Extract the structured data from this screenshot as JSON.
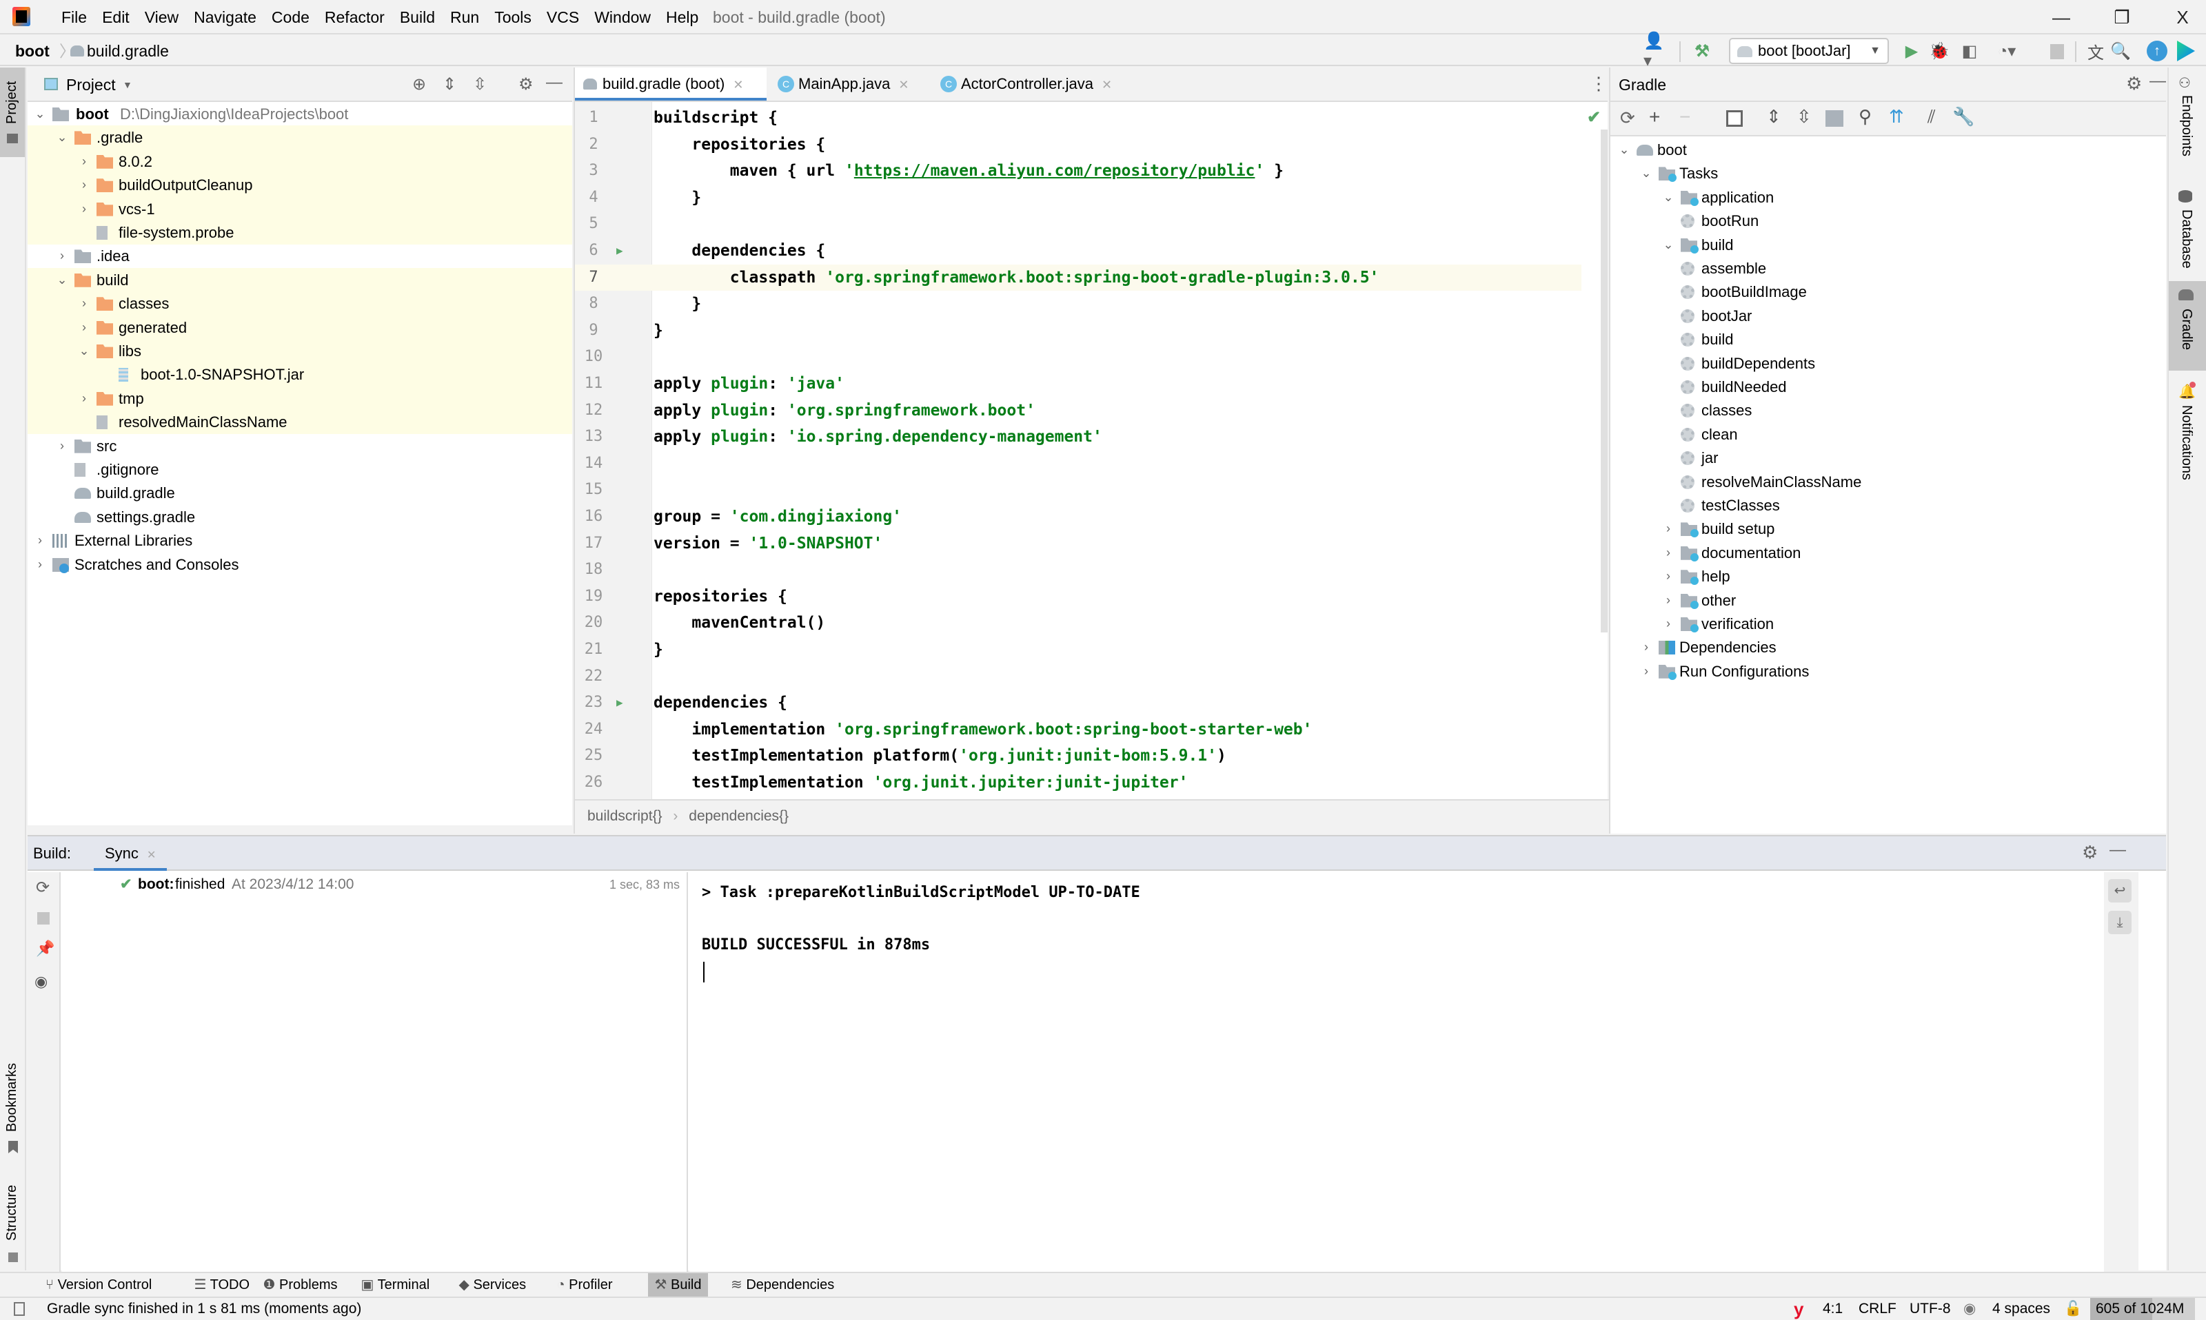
{
  "window": {
    "title": "boot - build.gradle (boot)",
    "menu": [
      "File",
      "Edit",
      "View",
      "Navigate",
      "Code",
      "Refactor",
      "Build",
      "Run",
      "Tools",
      "VCS",
      "Window",
      "Help"
    ],
    "controls": {
      "minimize": "—",
      "restore": "❐",
      "close": "X"
    }
  },
  "navbar": {
    "project": "boot",
    "file": "build.gradle",
    "run_config": "boot [bootJar]"
  },
  "left_stripe": {
    "top_tab": "Project",
    "bottom_tabs": [
      "Bookmarks",
      "Structure"
    ]
  },
  "project_panel": {
    "title": "Project",
    "root": {
      "name": "boot",
      "path": "D:\\DingJiaxiong\\IdeaProjects\\boot"
    },
    "items": [
      {
        "label": ".gradle",
        "depth": 1,
        "type": "folder-orange",
        "state": "expanded",
        "hl": true
      },
      {
        "label": "8.0.2",
        "depth": 2,
        "type": "folder-orange",
        "state": "collapsed",
        "hl": true
      },
      {
        "label": "buildOutputCleanup",
        "depth": 2,
        "type": "folder-orange",
        "state": "collapsed",
        "hl": true
      },
      {
        "label": "vcs-1",
        "depth": 2,
        "type": "folder-orange",
        "state": "collapsed",
        "hl": true
      },
      {
        "label": "file-system.probe",
        "depth": 2,
        "type": "file",
        "state": "none",
        "hl": true
      },
      {
        "label": ".idea",
        "depth": 1,
        "type": "folder-gray",
        "state": "collapsed",
        "hl": false
      },
      {
        "label": "build",
        "depth": 1,
        "type": "folder-orange",
        "state": "expanded",
        "hl": true
      },
      {
        "label": "classes",
        "depth": 2,
        "type": "folder-orange",
        "state": "collapsed",
        "hl": true
      },
      {
        "label": "generated",
        "depth": 2,
        "type": "folder-orange",
        "state": "collapsed",
        "hl": true
      },
      {
        "label": "libs",
        "depth": 2,
        "type": "folder-orange",
        "state": "expanded",
        "hl": true
      },
      {
        "label": "boot-1.0-SNAPSHOT.jar",
        "depth": 3,
        "type": "jar",
        "state": "none",
        "hl": true
      },
      {
        "label": "tmp",
        "depth": 2,
        "type": "folder-orange",
        "state": "collapsed",
        "hl": true
      },
      {
        "label": "resolvedMainClassName",
        "depth": 2,
        "type": "file",
        "state": "none",
        "hl": true
      },
      {
        "label": "src",
        "depth": 1,
        "type": "folder-gray",
        "state": "collapsed",
        "hl": false
      },
      {
        "label": ".gitignore",
        "depth": 1,
        "type": "file",
        "state": "none",
        "hl": false
      },
      {
        "label": "build.gradle",
        "depth": 1,
        "type": "gradle",
        "state": "none",
        "hl": false
      },
      {
        "label": "settings.gradle",
        "depth": 1,
        "type": "gradle",
        "state": "none",
        "hl": false
      },
      {
        "label": "External Libraries",
        "depth": 0,
        "type": "lib",
        "state": "collapsed",
        "hl": false
      },
      {
        "label": "Scratches and Consoles",
        "depth": 0,
        "type": "scratch",
        "state": "collapsed",
        "hl": false
      }
    ]
  },
  "editor": {
    "tabs": [
      {
        "label": "build.gradle (boot)",
        "active": true
      },
      {
        "label": "MainApp.java",
        "active": false
      },
      {
        "label": "ActorController.java",
        "active": false
      }
    ],
    "lines": [
      {
        "n": "1",
        "parts": [
          [
            "t",
            "buildscript {"
          ]
        ]
      },
      {
        "n": "2",
        "parts": [
          [
            "t",
            "    repositories {"
          ]
        ]
      },
      {
        "n": "3",
        "parts": [
          [
            "t",
            "        maven { url "
          ],
          [
            "s",
            "'"
          ],
          [
            "u",
            "https://maven.aliyun.com/repository/public"
          ],
          [
            "s",
            "'"
          ],
          [
            "t",
            " }"
          ]
        ]
      },
      {
        "n": "4",
        "parts": [
          [
            "t",
            "    }"
          ]
        ]
      },
      {
        "n": "5",
        "parts": []
      },
      {
        "n": "6",
        "parts": [
          [
            "t",
            "    dependencies {"
          ]
        ],
        "run": true
      },
      {
        "n": "7",
        "parts": [
          [
            "t",
            "        classpath "
          ],
          [
            "s",
            "'org.springframework.boot:spring-boot-gradle-plugin:3.0.5'"
          ]
        ],
        "current": true
      },
      {
        "n": "8",
        "parts": [
          [
            "t",
            "    }"
          ]
        ]
      },
      {
        "n": "9",
        "parts": [
          [
            "t",
            "}"
          ]
        ]
      },
      {
        "n": "10",
        "parts": []
      },
      {
        "n": "11",
        "parts": [
          [
            "t",
            "apply "
          ],
          [
            "k",
            "plugin"
          ],
          [
            "t",
            ": "
          ],
          [
            "s",
            "'java'"
          ]
        ]
      },
      {
        "n": "12",
        "parts": [
          [
            "t",
            "apply "
          ],
          [
            "k",
            "plugin"
          ],
          [
            "t",
            ": "
          ],
          [
            "s",
            "'org.springframework.boot'"
          ]
        ]
      },
      {
        "n": "13",
        "parts": [
          [
            "t",
            "apply "
          ],
          [
            "k",
            "plugin"
          ],
          [
            "t",
            ": "
          ],
          [
            "s",
            "'io.spring.dependency-management'"
          ]
        ]
      },
      {
        "n": "14",
        "parts": []
      },
      {
        "n": "15",
        "parts": []
      },
      {
        "n": "16",
        "parts": [
          [
            "t",
            "group = "
          ],
          [
            "s",
            "'com.dingjiaxiong'"
          ]
        ]
      },
      {
        "n": "17",
        "parts": [
          [
            "t",
            "version = "
          ],
          [
            "s",
            "'1.0-SNAPSHOT'"
          ]
        ]
      },
      {
        "n": "18",
        "parts": []
      },
      {
        "n": "19",
        "parts": [
          [
            "t",
            "repositories {"
          ]
        ]
      },
      {
        "n": "20",
        "parts": [
          [
            "t",
            "    mavenCentral()"
          ]
        ]
      },
      {
        "n": "21",
        "parts": [
          [
            "t",
            "}"
          ]
        ]
      },
      {
        "n": "22",
        "parts": []
      },
      {
        "n": "23",
        "parts": [
          [
            "t",
            "dependencies {"
          ]
        ],
        "run": true
      },
      {
        "n": "24",
        "parts": [
          [
            "t",
            "    implementation "
          ],
          [
            "s",
            "'org.springframework.boot:spring-boot-starter-web'"
          ]
        ]
      },
      {
        "n": "25",
        "parts": [
          [
            "t",
            "    testImplementation platform("
          ],
          [
            "s",
            "'org.junit:junit-bom:5.9.1'"
          ],
          [
            "t",
            ")"
          ]
        ]
      },
      {
        "n": "26",
        "parts": [
          [
            "t",
            "    testImplementation "
          ],
          [
            "s",
            "'org.junit.jupiter:junit-jupiter'"
          ]
        ]
      }
    ],
    "breadcrumbs": [
      "buildscript{}",
      "dependencies{}"
    ]
  },
  "gradle_panel": {
    "title": "Gradle",
    "tree": [
      {
        "label": "boot",
        "depth": 0,
        "type": "gradle",
        "state": "expanded"
      },
      {
        "label": "Tasks",
        "depth": 1,
        "type": "taskfolder",
        "state": "expanded"
      },
      {
        "label": "application",
        "depth": 2,
        "type": "taskfolder",
        "state": "expanded"
      },
      {
        "label": "bootRun",
        "depth": 3,
        "type": "task",
        "state": "none"
      },
      {
        "label": "build",
        "depth": 2,
        "type": "taskfolder",
        "state": "expanded"
      },
      {
        "label": "assemble",
        "depth": 3,
        "type": "task",
        "state": "none"
      },
      {
        "label": "bootBuildImage",
        "depth": 3,
        "type": "task",
        "state": "none"
      },
      {
        "label": "bootJar",
        "depth": 3,
        "type": "task",
        "state": "none"
      },
      {
        "label": "build",
        "depth": 3,
        "type": "task",
        "state": "none"
      },
      {
        "label": "buildDependents",
        "depth": 3,
        "type": "task",
        "state": "none"
      },
      {
        "label": "buildNeeded",
        "depth": 3,
        "type": "task",
        "state": "none"
      },
      {
        "label": "classes",
        "depth": 3,
        "type": "task",
        "state": "none"
      },
      {
        "label": "clean",
        "depth": 3,
        "type": "task",
        "state": "none"
      },
      {
        "label": "jar",
        "depth": 3,
        "type": "task",
        "state": "none"
      },
      {
        "label": "resolveMainClassName",
        "depth": 3,
        "type": "task",
        "state": "none"
      },
      {
        "label": "testClasses",
        "depth": 3,
        "type": "task",
        "state": "none"
      },
      {
        "label": "build setup",
        "depth": 2,
        "type": "taskfolder",
        "state": "collapsed"
      },
      {
        "label": "documentation",
        "depth": 2,
        "type": "taskfolder",
        "state": "collapsed"
      },
      {
        "label": "help",
        "depth": 2,
        "type": "taskfolder",
        "state": "collapsed"
      },
      {
        "label": "other",
        "depth": 2,
        "type": "taskfolder",
        "state": "collapsed"
      },
      {
        "label": "verification",
        "depth": 2,
        "type": "taskfolder",
        "state": "collapsed"
      },
      {
        "label": "Dependencies",
        "depth": 1,
        "type": "deps",
        "state": "collapsed"
      },
      {
        "label": "Run Configurations",
        "depth": 1,
        "type": "taskfolder",
        "state": "collapsed"
      }
    ]
  },
  "right_stripe": {
    "tabs": [
      "Endpoints",
      "Database",
      "Gradle",
      "Notifications"
    ]
  },
  "build_panel": {
    "label": "Build:",
    "tab": "Sync",
    "entry": {
      "project": "boot:",
      "status": "finished",
      "time": "At 2023/4/12 14:00",
      "duration": "1 sec, 83 ms"
    },
    "console": [
      "> Task :prepareKotlinBuildScriptModel UP-TO-DATE",
      "",
      "BUILD SUCCESSFUL in 878ms"
    ]
  },
  "tool_windows": [
    "Version Control",
    "TODO",
    "Problems",
    "Terminal",
    "Services",
    "Profiler",
    "Build",
    "Dependencies"
  ],
  "tool_windows_active": "Build",
  "status_bar": {
    "message": "Gradle sync finished in 1 s 81 ms (moments ago)",
    "position": "4:1",
    "line_sep": "CRLF",
    "encoding": "UTF-8",
    "indent": "4 spaces",
    "memory": "605 of 1024M",
    "memory_used_fraction": 0.59
  },
  "colors": {
    "accent": "#4083c9",
    "string": "#067d17",
    "success": "#59a869",
    "highlight_row": "#fefde4",
    "folder": "#f4a36d"
  }
}
